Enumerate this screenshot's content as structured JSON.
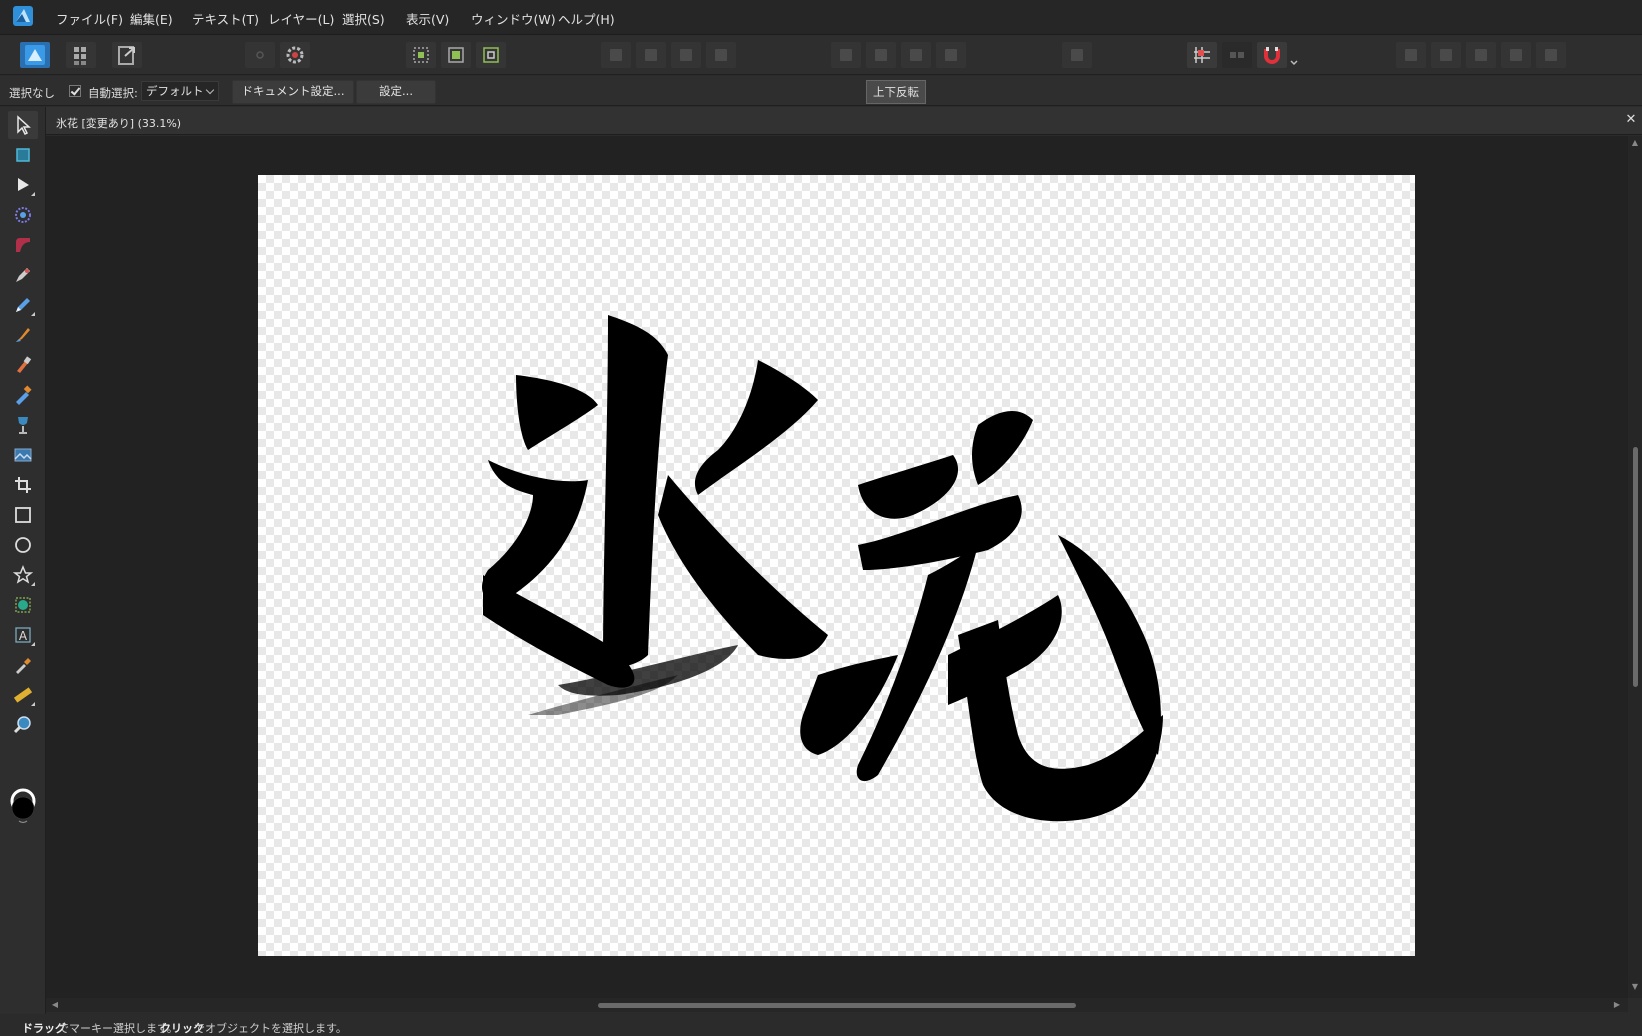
{
  "app": {
    "name": "Affinity Designer",
    "accent": "#2f8fd8"
  },
  "menu": {
    "items": [
      "ファイル(F)",
      "編集(E)",
      "テキスト(T)",
      "レイヤー(L)",
      "選択(S)",
      "表示(V)",
      "ウィンドウ(W)",
      "ヘルプ(H)"
    ]
  },
  "toolbar": {
    "persona_icons": [
      "designer-persona-icon",
      "pixel-persona-icon",
      "export-persona-icon"
    ],
    "snapping_color": "#e0303a"
  },
  "context": {
    "selection": "選択なし",
    "auto_select_label": "自動選択:",
    "auto_select_checked": true,
    "auto_select_value": "デフォルト",
    "doc_settings_button": "ドキュメント設定...",
    "settings_button": "設定...",
    "tooltip": "上下反転"
  },
  "document": {
    "tab_title": "氷花 [変更あり] (33.1%)",
    "zoom": "33.1%",
    "artwork_text": "氷花"
  },
  "colors": {
    "fill": "#000000",
    "stroke": "#ffffff"
  },
  "status": {
    "drag": "ドラッグ",
    "drag_text": "でマーキー選択します。",
    "click": "クリック",
    "click_text": "でオブジェクトを選択します。"
  }
}
